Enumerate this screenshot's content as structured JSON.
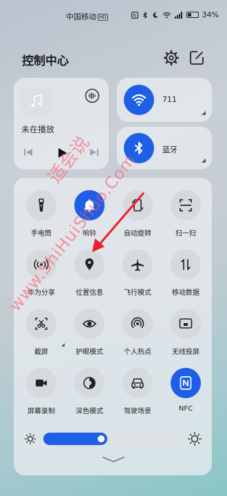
{
  "status_bar": {
    "carrier": "中国移动",
    "hd_badge": "HD",
    "battery_percent": "34%",
    "icons": [
      "nfc-icon",
      "bluetooth-icon",
      "moon-icon",
      "wifi-icon",
      "signal-icon",
      "battery-icon"
    ]
  },
  "header": {
    "title": "控制中心",
    "icons": [
      "gear-icon",
      "edit-icon"
    ]
  },
  "media": {
    "status": "未在播放",
    "icons": [
      "music-note-icon",
      "audio-output-icon",
      "previous-icon",
      "play-icon",
      "next-icon"
    ]
  },
  "wifi": {
    "label": "711",
    "active": true
  },
  "bluetooth": {
    "label": "蓝牙",
    "active": true
  },
  "tiles": [
    {
      "label": "手电筒",
      "icon": "flashlight-icon",
      "active": false
    },
    {
      "label": "响铃",
      "icon": "bell-icon",
      "active": true
    },
    {
      "label": "自动旋转",
      "icon": "rotate-icon",
      "active": false
    },
    {
      "label": "扫一扫",
      "icon": "scan-icon",
      "active": false
    },
    {
      "label": "华为分享",
      "icon": "share-icon",
      "active": false
    },
    {
      "label": "位置信息",
      "icon": "location-icon",
      "active": false
    },
    {
      "label": "飞行模式",
      "icon": "airplane-icon",
      "active": false
    },
    {
      "label": "移动数据",
      "icon": "mobile-data-icon",
      "active": false
    },
    {
      "label": "截屏",
      "icon": "screenshot-icon",
      "active": false
    },
    {
      "label": "护眼模式",
      "icon": "eye-icon",
      "active": false
    },
    {
      "label": "个人热点",
      "icon": "hotspot-icon",
      "active": false
    },
    {
      "label": "无线投屏",
      "icon": "cast-icon",
      "active": false
    },
    {
      "label": "屏幕录制",
      "icon": "record-icon",
      "active": false
    },
    {
      "label": "深色模式",
      "icon": "dark-mode-icon",
      "active": false
    },
    {
      "label": "驾驶场景",
      "icon": "car-icon",
      "active": false
    },
    {
      "label": "NFC",
      "icon": "nfc-icon",
      "active": true
    }
  ],
  "brightness": {
    "level": 0.46
  },
  "watermark": {
    "line1": "适会说",
    "line2": "www.ShiHuiShuo.Com"
  },
  "colors": {
    "accent": "#1f5fe6",
    "watermark": "#ff5064"
  }
}
